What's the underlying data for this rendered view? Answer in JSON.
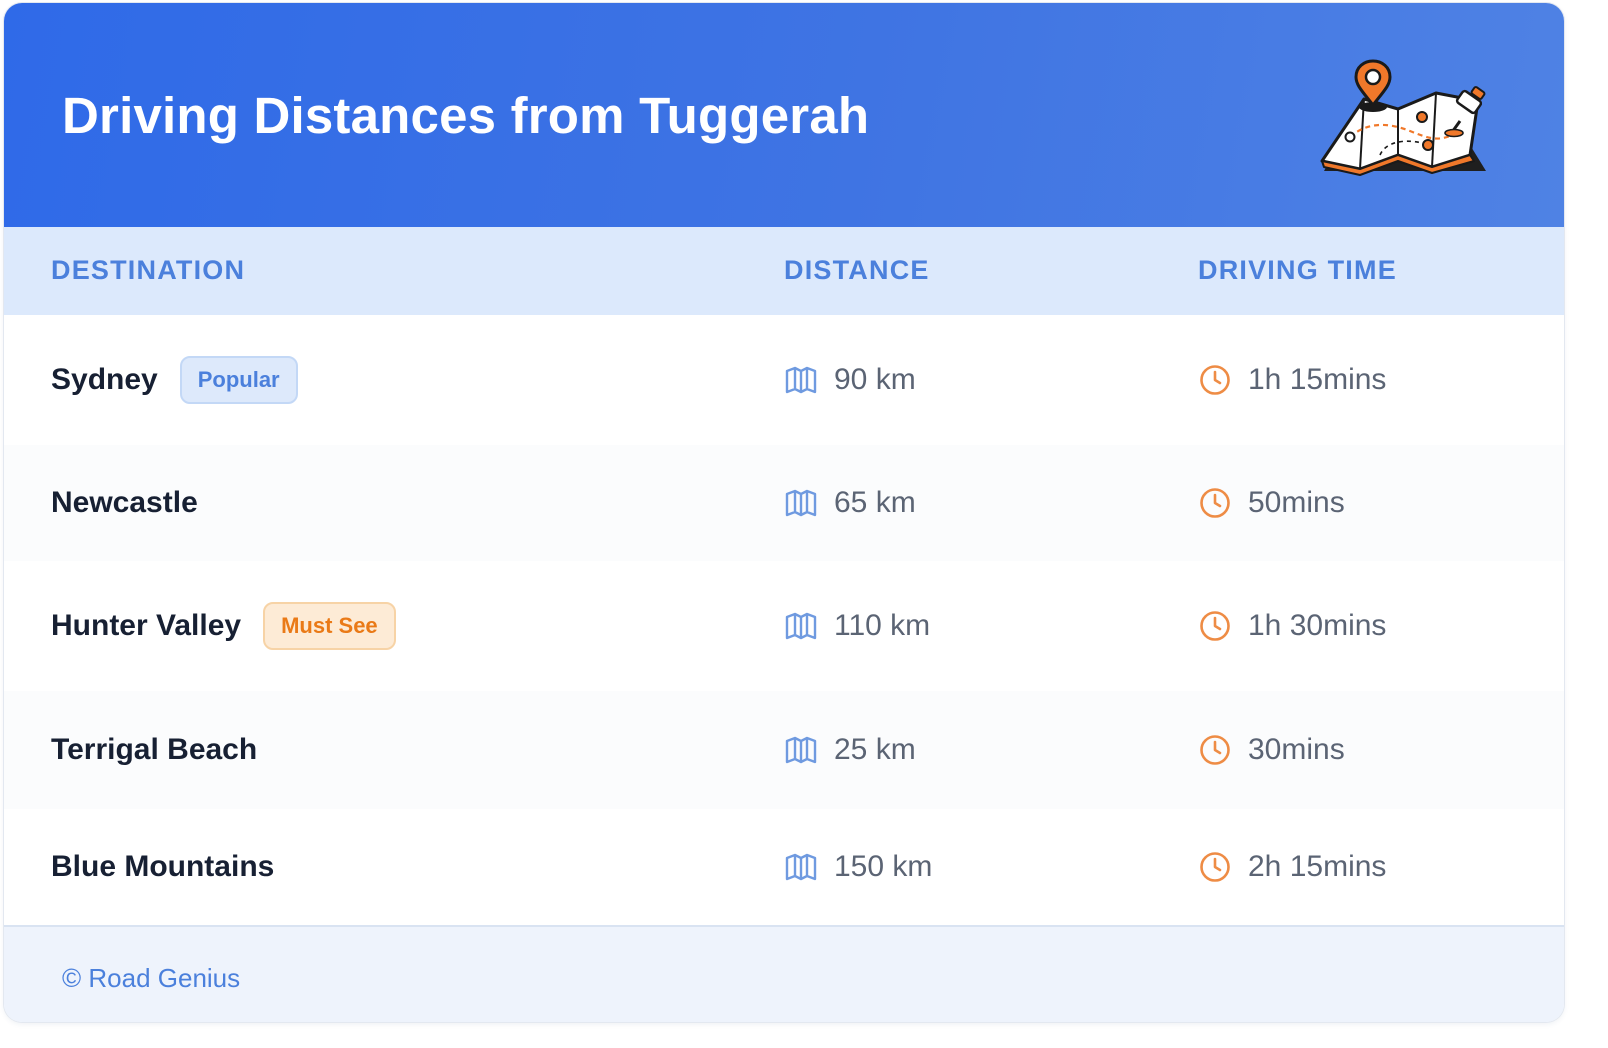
{
  "header": {
    "title": "Driving Distances from Tuggerah",
    "illustration": "folded-map-with-pins-icon"
  },
  "table": {
    "columns": [
      "DESTINATION",
      "DISTANCE",
      "DRIVING TIME"
    ],
    "rows": [
      {
        "destination": "Sydney",
        "badge": "Popular",
        "distance": "90 km",
        "time": "1h 15mins"
      },
      {
        "destination": "Newcastle",
        "badge": "",
        "distance": "65 km",
        "time": "50mins"
      },
      {
        "destination": "Hunter Valley",
        "badge": "Must See",
        "distance": "110 km",
        "time": "1h 30mins"
      },
      {
        "destination": "Terrigal Beach",
        "badge": "",
        "distance": "25 km",
        "time": "30mins"
      },
      {
        "destination": "Blue Mountains",
        "badge": "",
        "distance": "150 km",
        "time": "2h 15mins"
      }
    ],
    "distance_icon": "map-icon",
    "time_icon": "clock-icon"
  },
  "footer": {
    "credit": "© Road Genius"
  },
  "colors": {
    "header_gradient_start": "#2f6ae8",
    "header_gradient_end": "#4f82e4",
    "accent_blue": "#4b80dc",
    "accent_orange": "#ea7a17",
    "table_header_bg": "#dce9fc"
  }
}
